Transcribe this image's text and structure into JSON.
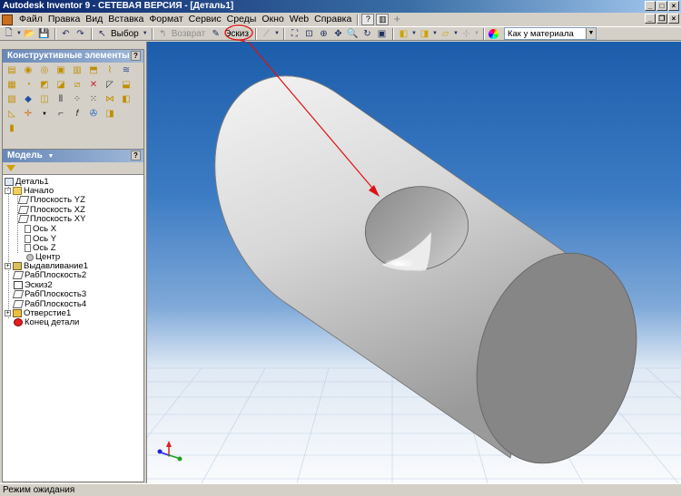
{
  "title_bar": {
    "title": "Autodesk Inventor 9  - СЕТЕВАЯ ВЕРСИЯ - [Деталь1]"
  },
  "menu": {
    "items": [
      "Файл",
      "Правка",
      "Вид",
      "Вставка",
      "Формат",
      "Сервис",
      "Среды",
      "Окно",
      "Web",
      "Справка"
    ]
  },
  "toolbar": {
    "select_label": "Выбор",
    "return_label": "Возврат",
    "sketch_label": "Эскиз",
    "material_value": "Как у материала"
  },
  "features_panel": {
    "title": "Конструктивные элементы"
  },
  "model_panel": {
    "title": "Модель",
    "tree": {
      "part": "Деталь1",
      "origin": "Начало",
      "plane_yz": "Плоскость YZ",
      "plane_xz": "Плоскость XZ",
      "plane_xy": "Плоскость XY",
      "axis_x": "Ось X",
      "axis_y": "Ось Y",
      "axis_z": "Ось Z",
      "center": "Центр",
      "extrude": "Выдавливание1",
      "workplane2": "РабПлоскость2",
      "sketch2": "Эскиз2",
      "workplane3": "РабПлоскость3",
      "workplane4": "РабПлоскость4",
      "hole": "Отверстие1",
      "end": "Конец детали"
    }
  },
  "status_bar": {
    "text": "Режим ожидания"
  },
  "colors": {
    "annotation": "#e01010",
    "viewport_top": "#1c5dab",
    "viewport_bottom": "#fafbfd",
    "part_face": "#cfcfcf",
    "title_bar": "#0a246a"
  }
}
